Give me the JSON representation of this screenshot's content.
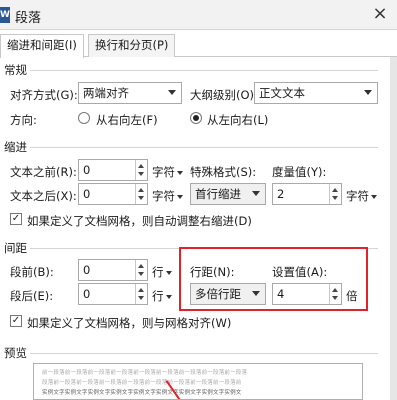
{
  "window": {
    "icon_glyph": "W",
    "title": "段落",
    "close_glyph": "×"
  },
  "tabs": [
    {
      "label": "缩进和间距(I)",
      "active": true
    },
    {
      "label": "换行和分页(P)",
      "active": false
    }
  ],
  "general": {
    "title": "常规",
    "alignment_label": "对齐方式(G):",
    "alignment_value": "两端对齐",
    "outline_label": "大纲级别(O):",
    "outline_value": "正文文本",
    "direction_label": "方向:",
    "rtl_label": "从右向左(F)",
    "ltr_label": "从左向右(L)",
    "direction_selected": "ltr"
  },
  "indent": {
    "title": "缩进",
    "before_label": "文本之前(R):",
    "before_value": "0",
    "before_unit": "字符",
    "after_label": "文本之后(X):",
    "after_value": "0",
    "after_unit": "字符",
    "special_label": "特殊格式(S):",
    "special_value": "首行缩进",
    "measure_label": "度量值(Y):",
    "measure_value": "2",
    "measure_unit": "字符",
    "auto_adjust_label": "如果定义了文档网格，则自动调整右缩进(D)",
    "auto_adjust_checked": true
  },
  "spacing": {
    "title": "间距",
    "before_label": "段前(B):",
    "before_value": "0",
    "before_unit": "行",
    "after_label": "段后(E):",
    "after_value": "0",
    "after_unit": "行",
    "line_spacing_label": "行距(N):",
    "line_spacing_value": "多倍行距",
    "set_value_label": "设置值(A):",
    "set_value": "4",
    "set_value_unit": "倍",
    "snap_grid_label": "如果定义了文档网格，则与网格对齐(W)",
    "snap_grid_checked": true
  },
  "preview": {
    "title": "预览",
    "rows": [
      "前一段落前一段落前一段落前一段落前一段落前一段落前一段落前一段落前一段落",
      "段落前一段落前一段落前一段落前一段落前一段落前一段落前一段落前一段落前",
      "实例文字实例文字实例文字实例文字实例文字实例文字实例文字实例文字实例文"
    ]
  },
  "colors": {
    "highlight": "#e0222a"
  },
  "icons": {
    "app": "app-icon",
    "close": "close-icon",
    "dropdown": "chevron-down-icon",
    "spin_up": "spin-up-icon",
    "spin_down": "spin-down-icon",
    "check": "check-icon"
  }
}
